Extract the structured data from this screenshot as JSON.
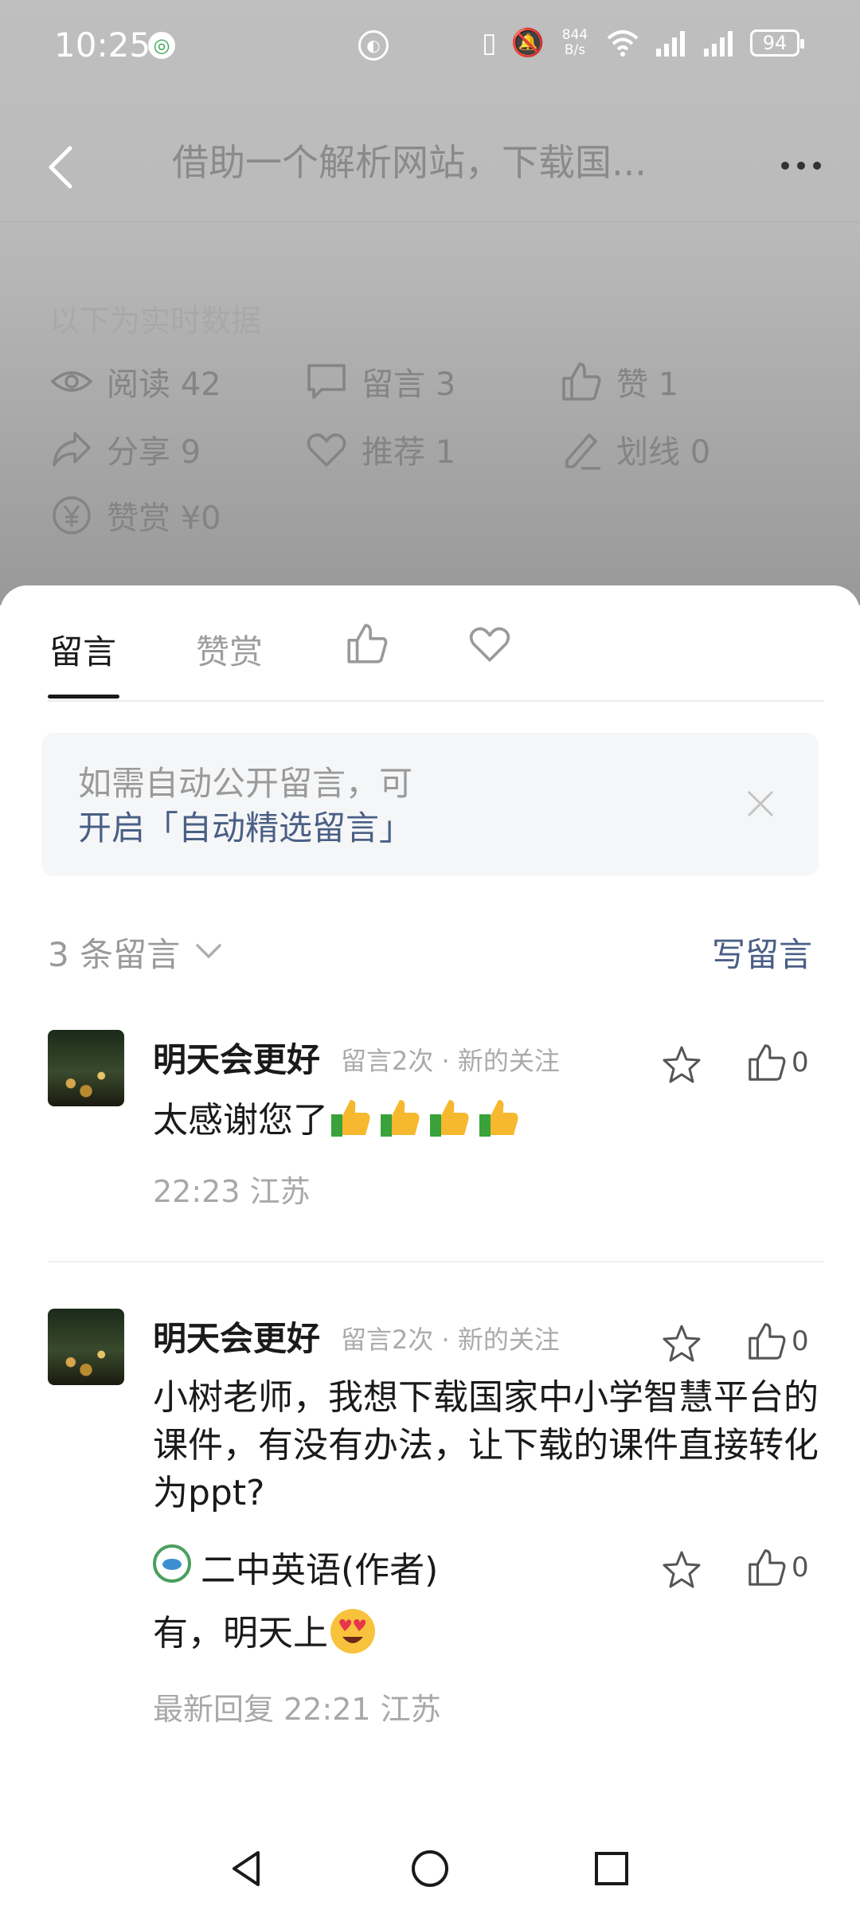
{
  "status_bar": {
    "time": "10:25",
    "net_speed_value": "844",
    "net_speed_unit": "B/s",
    "battery": "94"
  },
  "header": {
    "title": "借助一个解析网站，下载国..."
  },
  "stats": {
    "realtime_label": "以下为实时数据",
    "items": [
      {
        "label": "阅读 42",
        "icon": "eye-icon"
      },
      {
        "label": "留言 3",
        "icon": "comment-icon"
      },
      {
        "label": "赞 1",
        "icon": "thumbs-up-icon"
      },
      {
        "label": "分享 9",
        "icon": "share-icon"
      },
      {
        "label": "推荐 1",
        "icon": "heart-icon"
      },
      {
        "label": "划线 0",
        "icon": "pencil-icon"
      },
      {
        "label": "赞赏 ¥0",
        "icon": "yen-icon"
      }
    ]
  },
  "sheet": {
    "tabs": [
      {
        "label": "留言",
        "active": true
      },
      {
        "label": "赞赏",
        "active": false
      }
    ],
    "notice": {
      "prefix": "如需自动公开留言，可",
      "link": "开启「自动精选留言」"
    },
    "count_label": "3 条留言",
    "write_comment": "写留言",
    "comments": [
      {
        "name": "明天会更好",
        "meta": "留言2次 · 新的关注",
        "text": "太感谢您了",
        "emoji": "thumbs-up-emoji",
        "time": "22:23  江苏",
        "likes": "0"
      },
      {
        "name": "明天会更好",
        "meta": "留言2次 · 新的关注",
        "text": "小树老师，我想下载国家中小学智慧平台的课件，有没有办法，让下载的课件直接转化为ppt?",
        "likes": "0",
        "reply": {
          "name": "二中英语(作者)",
          "text": "有，明天上",
          "emoji": "heart-eyes-emoji",
          "time": "最新回复 22:21  江苏",
          "likes": "0"
        }
      }
    ]
  },
  "colors": {
    "link": "#4a5f85",
    "text_primary": "#1a1a1a",
    "text_secondary": "#9a9a9a"
  }
}
